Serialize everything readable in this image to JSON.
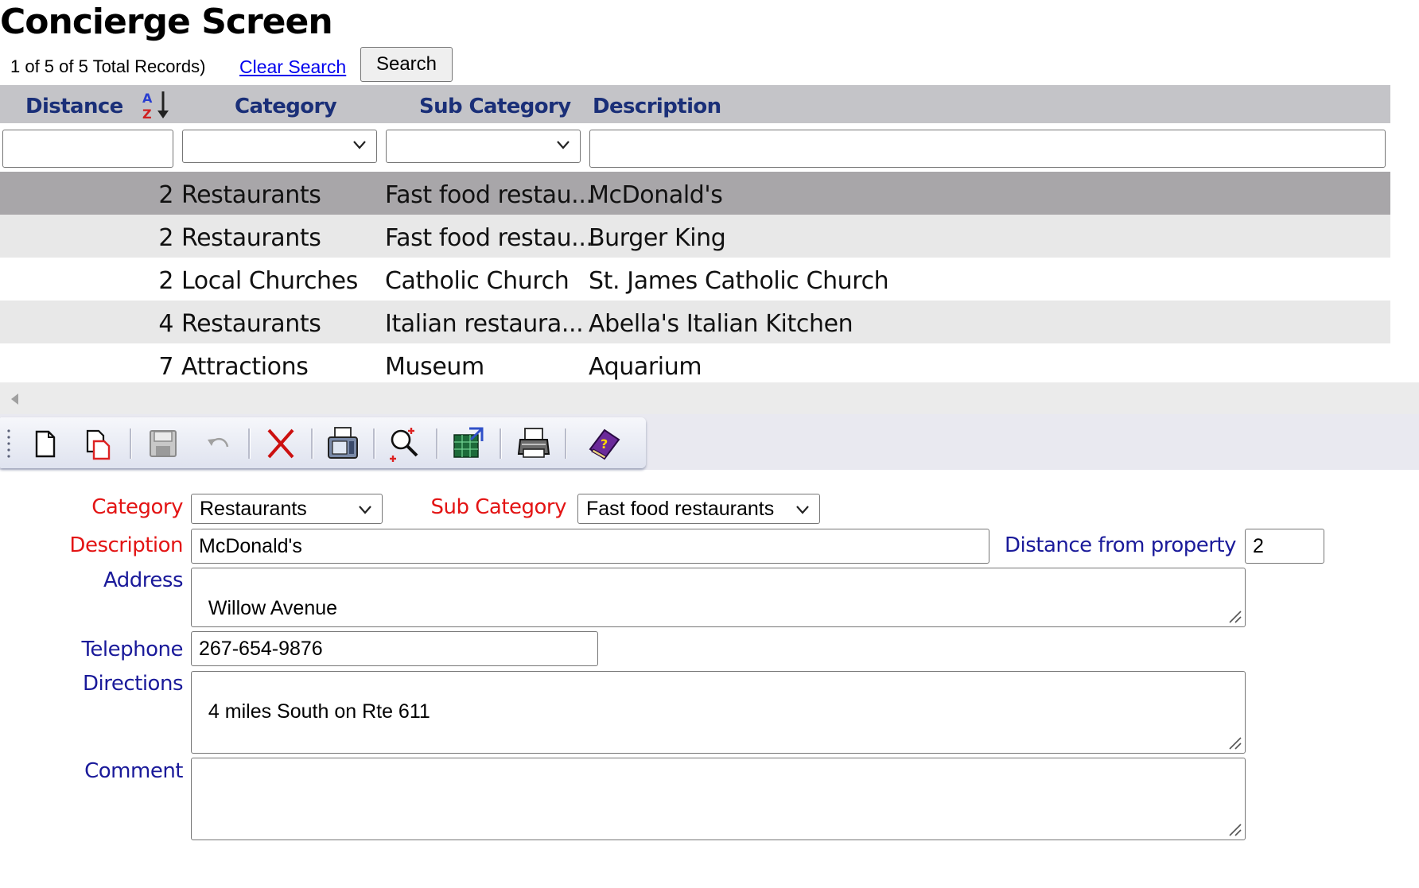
{
  "page": {
    "title": "Concierge Screen"
  },
  "record_bar": {
    "count_text": "1 of 5 of 5 Total Records)",
    "clear_search": "Clear Search",
    "search_button": "Search"
  },
  "grid": {
    "columns": [
      "Distance",
      "Category",
      "Sub Category",
      "Description"
    ],
    "sort_icon": "sort-a-z-icon",
    "rows": [
      {
        "distance": "2",
        "category": "Restaurants",
        "sub_category": "Fast food restau...",
        "description": "McDonald's",
        "selected": true
      },
      {
        "distance": "2",
        "category": "Restaurants",
        "sub_category": "Fast food restau...",
        "description": "Burger King"
      },
      {
        "distance": "2",
        "category": "Local Churches",
        "sub_category": "Catholic Church",
        "description": "St. James Catholic Church"
      },
      {
        "distance": "4",
        "category": "Restaurants",
        "sub_category": "Italian restaura...",
        "description": "Abella's Italian Kitchen"
      },
      {
        "distance": "7",
        "category": "Attractions",
        "sub_category": "Museum",
        "description": "Aquarium"
      }
    ]
  },
  "toolbar": {
    "buttons": [
      "new-record-icon",
      "copy-record-icon",
      "save-icon",
      "undo-icon",
      "delete-icon",
      "fax-icon",
      "search-add-icon",
      "export-icon",
      "print-icon",
      "help-book-icon"
    ]
  },
  "form": {
    "category_label": "Category",
    "category_value": "Restaurants",
    "sub_category_label": "Sub Category",
    "sub_category_value": "Fast food restaurants",
    "description_label": "Description",
    "description_value": "McDonald's",
    "distance_label": "Distance from property",
    "distance_value": "2",
    "address_label": "Address",
    "address_value": "Willow Avenue",
    "telephone_label": "Telephone",
    "telephone_value": "267-654-9876",
    "directions_label": "Directions",
    "directions_value": "4 miles South on Rte 611",
    "comment_label": "Comment",
    "comment_value": ""
  },
  "colors": {
    "header_bg": "#c4c4c8",
    "header_text": "#1a2f78",
    "selected_row": "#a8a6a9",
    "alt_row": "#e8e8e8",
    "required_label": "#e31414",
    "optional_label": "#1a1a9a",
    "link": "#0000ee"
  }
}
